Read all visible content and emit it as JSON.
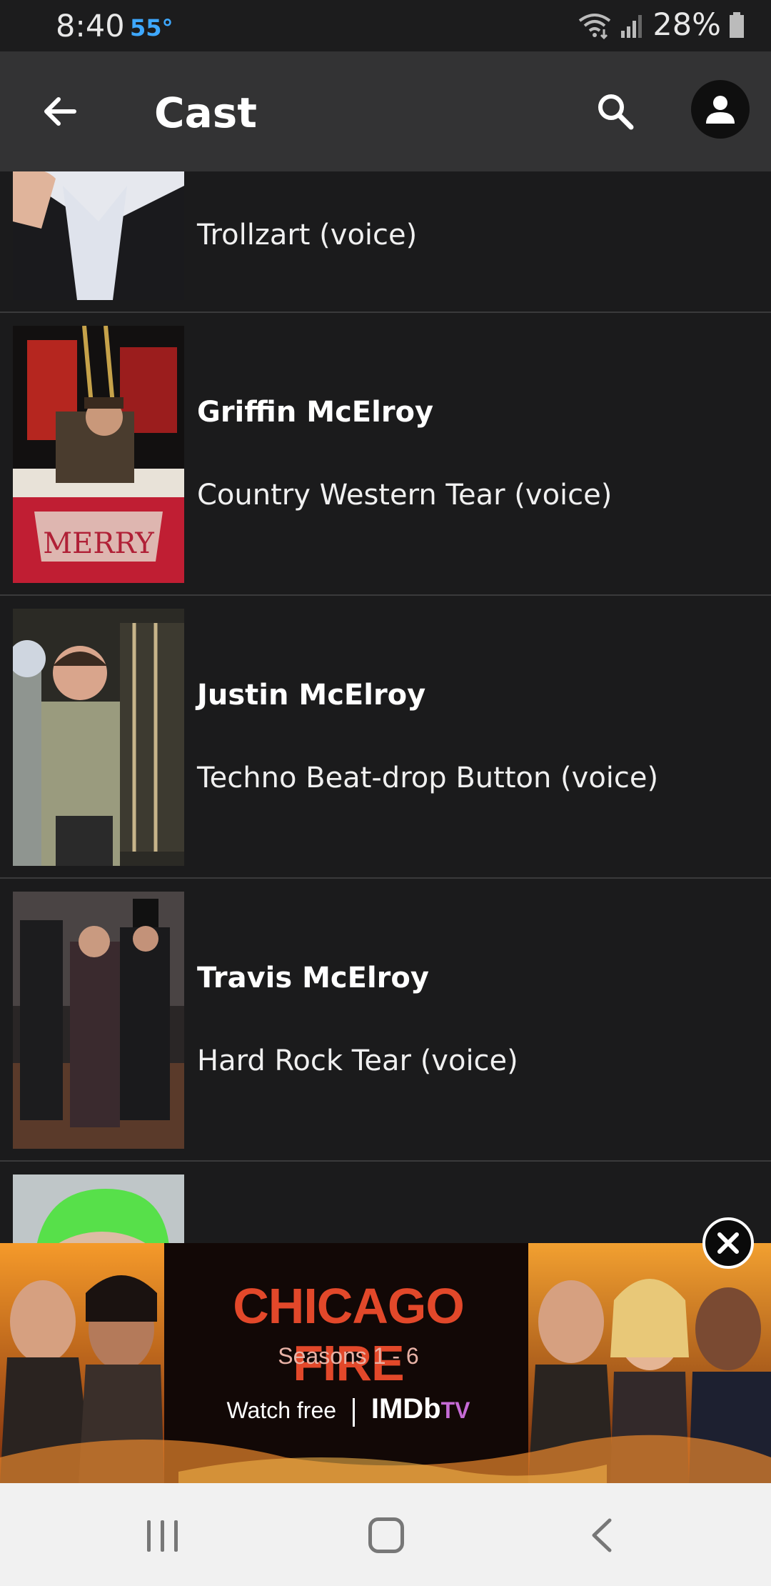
{
  "status_bar": {
    "time": "8:40",
    "temperature": "55°",
    "battery": "28%"
  },
  "header": {
    "title": "Cast"
  },
  "cast": [
    {
      "name": "",
      "role": "Trollzart (voice)"
    },
    {
      "name": "Griffin McElroy",
      "role": "Country Western Tear (voice)"
    },
    {
      "name": "Justin McElroy",
      "role": "Techno Beat-drop Button (voice)"
    },
    {
      "name": "Travis McElroy",
      "role": "Hard Rock Tear (voice)"
    }
  ],
  "ad": {
    "headline": "CHICAGO FIRE",
    "subtitle": "Seasons 1 - 6",
    "cta": "Watch free",
    "brand": "IMDb",
    "brand_suffix": "TV"
  },
  "colors": {
    "background": "#1b1b1c",
    "app_bar": "#333334",
    "ad_headline": "#e2482a"
  }
}
